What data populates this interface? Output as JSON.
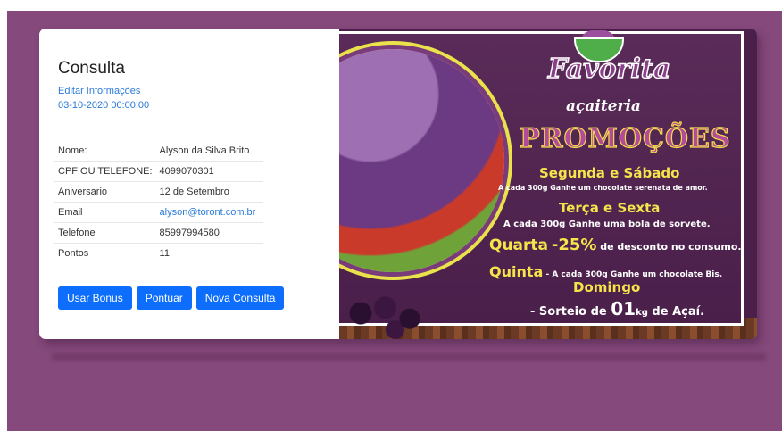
{
  "consulta": {
    "title": "Consulta",
    "edit_link": "Editar Informações",
    "datetime": "03-10-2020 00:00:00",
    "fields": [
      {
        "label": "Nome:",
        "value": "Alyson da Silva Brito"
      },
      {
        "label": "CPF OU TELEFONE:",
        "value": "4099070301"
      },
      {
        "label": "Aniversario",
        "value": "12 de Setembro"
      },
      {
        "label": "Email",
        "value": "alyson@toront.com.br"
      },
      {
        "label": "Telefone",
        "value": "85997994580"
      },
      {
        "label": "Pontos",
        "value": "11"
      }
    ],
    "buttons": {
      "usar_bonus": "Usar Bonus",
      "pontuar": "Pontuar",
      "nova_consulta": "Nova Consulta"
    }
  },
  "banner": {
    "brand": "Favorita",
    "brand_sub": "açaiteria",
    "headline": "PROMOÇÕES",
    "day1": "Segunda e Sábado",
    "promo1": "A cada 300g Ganhe um chocolate serenata de amor.",
    "day2": "Terça e Sexta",
    "promo2": "A cada 300g Ganhe uma bola de sorvete.",
    "day3": "Quarta",
    "promo3_value": "-25%",
    "promo3_text": "de desconto no consumo.",
    "day4": "Quinta",
    "promo4": "- A cada 300g Ganhe um chocolate Bis.",
    "day5": "Domingo",
    "promo5_prefix": "- Sorteio de",
    "promo5_number": "01",
    "promo5_unit": "kg",
    "promo5_suffix": "de Açaí."
  },
  "colors": {
    "background": "#85497b",
    "accent": "#0d6efd",
    "link": "#2a7ad8",
    "promo_yellow": "#f5e44a"
  }
}
